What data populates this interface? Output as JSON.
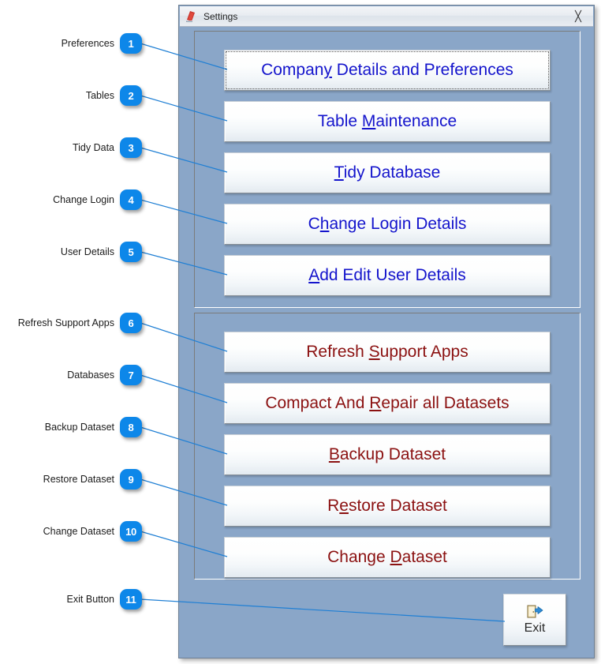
{
  "window": {
    "title": "Settings",
    "icon": "access-app-icon",
    "close_label": "╳",
    "background_color": "#8aa6c8"
  },
  "colors": {
    "badge_blue": "#0d87e9",
    "leader_line": "#1f7fd4",
    "admin_text": "#1414cc",
    "data_text": "#8b1111",
    "window_bg": "#8aa6c8"
  },
  "groups": [
    {
      "name": "administration-group",
      "buttons": [
        {
          "pre": "Compan",
          "accel": "y",
          "post": " Details and Preferences",
          "color_class": "blue-text",
          "focused": true,
          "name": "company-details-and-preferences-button"
        },
        {
          "pre": "Table ",
          "accel": "M",
          "post": "aintenance",
          "color_class": "blue-text",
          "focused": false,
          "name": "table-maintenance-button"
        },
        {
          "pre": "",
          "accel": "T",
          "post": "idy Database",
          "color_class": "blue-text",
          "focused": false,
          "name": "tidy-database-button"
        },
        {
          "pre": "C",
          "accel": "h",
          "post": "ange Login Details",
          "color_class": "blue-text",
          "focused": false,
          "name": "change-login-details-button"
        },
        {
          "pre": "",
          "accel": "A",
          "post": "dd Edit User Details",
          "color_class": "blue-text",
          "focused": false,
          "name": "add-edit-user-details-button"
        }
      ]
    },
    {
      "name": "dataset-group",
      "buttons": [
        {
          "pre": "Refresh ",
          "accel": "S",
          "post": "upport Apps",
          "color_class": "red-text",
          "focused": false,
          "name": "refresh-support-apps-button"
        },
        {
          "pre": "Compact And ",
          "accel": "R",
          "post": "epair all Datasets",
          "color_class": "red-text",
          "focused": false,
          "name": "compact-and-repair-all-datasets-button"
        },
        {
          "pre": "",
          "accel": "B",
          "post": "ackup Dataset",
          "color_class": "red-text",
          "focused": false,
          "name": "backup-dataset-button"
        },
        {
          "pre": "R",
          "accel": "e",
          "post": "store Dataset",
          "color_class": "red-text",
          "focused": false,
          "name": "restore-dataset-button"
        },
        {
          "pre": "Change ",
          "accel": "D",
          "post": "ataset",
          "color_class": "red-text",
          "focused": false,
          "name": "change-dataset-button"
        }
      ]
    }
  ],
  "exit_button": {
    "label": "Exit",
    "icon": "exit-door-icon"
  },
  "callouts": [
    {
      "number": "1",
      "label": "Preferences",
      "name": "callout-preferences"
    },
    {
      "number": "2",
      "label": "Tables",
      "name": "callout-tables"
    },
    {
      "number": "3",
      "label": "Tidy Data",
      "name": "callout-tidy-data"
    },
    {
      "number": "4",
      "label": "Change Login",
      "name": "callout-change-login"
    },
    {
      "number": "5",
      "label": "User Details",
      "name": "callout-user-details"
    },
    {
      "number": "6",
      "label": "Refresh Support Apps",
      "name": "callout-refresh-support-apps"
    },
    {
      "number": "7",
      "label": "Databases",
      "name": "callout-databases"
    },
    {
      "number": "8",
      "label": "Backup Dataset",
      "name": "callout-backup-dataset"
    },
    {
      "number": "9",
      "label": "Restore Dataset",
      "name": "callout-restore-dataset"
    },
    {
      "number": "10",
      "label": "Change Dataset",
      "name": "callout-change-dataset"
    },
    {
      "number": "11",
      "label": "Exit Button",
      "name": "callout-exit-button"
    }
  ]
}
